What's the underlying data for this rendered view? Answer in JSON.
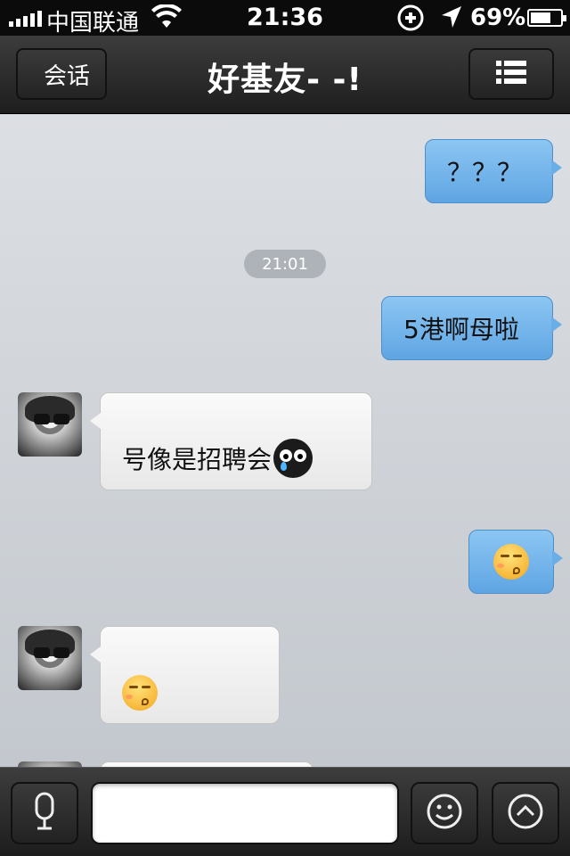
{
  "status_bar": {
    "carrier": "中国联通",
    "time": "21:36",
    "battery": "69%",
    "battery_level": 0.69
  },
  "nav": {
    "back_label": "会话",
    "title": "好基友- -!",
    "menu_icon": "list-icon"
  },
  "messages": [
    {
      "direction": "out",
      "text": "？？？"
    },
    {
      "type": "timestamp",
      "text": "21:01"
    },
    {
      "direction": "out",
      "text": "5港啊母啦"
    },
    {
      "direction": "in",
      "text": "号像是招聘会",
      "emoji": "crying-black-face-emoji"
    },
    {
      "direction": "out",
      "emoji": "kiss-face-emoji"
    },
    {
      "direction": "in",
      "emoji": "kiss-face-emoji"
    }
  ],
  "toolbar": {
    "voice_icon": "microphone-icon",
    "input_value": "",
    "input_placeholder": "",
    "emoji_icon": "smiley-icon",
    "more_icon": "chevron-up-circle-icon"
  },
  "colors": {
    "outgoing_bubble": "#6aaee8",
    "incoming_bubble": "#f4f4f4",
    "chat_background": "#cfd3d8",
    "bar_background": "#2a2a2a"
  }
}
